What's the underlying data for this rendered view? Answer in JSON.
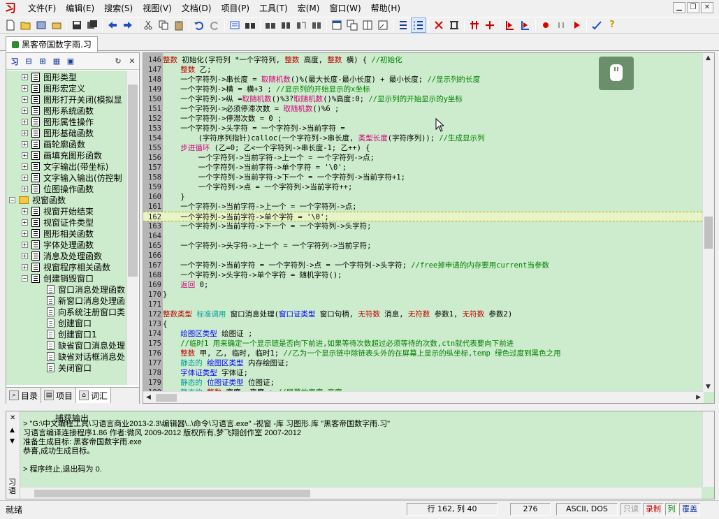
{
  "app": {
    "logo": "习"
  },
  "menu": [
    "文件(F)",
    "编辑(E)",
    "搜索(S)",
    "视图(V)",
    "文档(D)",
    "项目(P)",
    "工具(T)",
    "宏(M)",
    "窗口(W)",
    "帮助(H)"
  ],
  "doc_tab": "黑客帝国数字雨.习",
  "tree": [
    {
      "label": "图形类型",
      "level": 2,
      "icon": "book"
    },
    {
      "label": "图形宏定义",
      "level": 2,
      "icon": "book"
    },
    {
      "label": "图形打开关闭(模拟显",
      "level": 2,
      "icon": "book"
    },
    {
      "label": "图形系统函数",
      "level": 2,
      "icon": "book"
    },
    {
      "label": "图形属性操作",
      "level": 2,
      "icon": "book"
    },
    {
      "label": "图形基础函数",
      "level": 2,
      "icon": "book"
    },
    {
      "label": "画轮廓函数",
      "level": 2,
      "icon": "book"
    },
    {
      "label": "画填充图形函数",
      "level": 2,
      "icon": "book"
    },
    {
      "label": "文字输出(带坐标)",
      "level": 2,
      "icon": "book"
    },
    {
      "label": "文字输入输出(仿控制",
      "level": 2,
      "icon": "book"
    },
    {
      "label": "位图操作函数",
      "level": 2,
      "icon": "book"
    },
    {
      "label": "视窗函数",
      "level": 1,
      "icon": "folder"
    },
    {
      "label": "视窗开始结束",
      "level": 2,
      "icon": "book"
    },
    {
      "label": "视窗证件类型",
      "level": 2,
      "icon": "book"
    },
    {
      "label": "图形相关函数",
      "level": 2,
      "icon": "book"
    },
    {
      "label": "字体处理函数",
      "level": 2,
      "icon": "book"
    },
    {
      "label": "消息及处理函数",
      "level": 2,
      "icon": "book"
    },
    {
      "label": "视窗程序相关函数",
      "level": 2,
      "icon": "book"
    },
    {
      "label": "创建销毁窗口",
      "level": 2,
      "icon": "book"
    },
    {
      "label": "窗口消息处理函数",
      "level": 3,
      "icon": "page"
    },
    {
      "label": "新窗口消息处理函",
      "level": 3,
      "icon": "page"
    },
    {
      "label": "向系统注册窗口类",
      "level": 3,
      "icon": "page"
    },
    {
      "label": "创建窗口",
      "level": 3,
      "icon": "page"
    },
    {
      "label": "创建窗口1",
      "level": 3,
      "icon": "page"
    },
    {
      "label": "缺省窗口消息处理",
      "level": 3,
      "icon": "page"
    },
    {
      "label": "缺省对话框消息处",
      "level": 3,
      "icon": "page"
    },
    {
      "label": "关闭窗口",
      "level": 3,
      "icon": "page"
    }
  ],
  "left_tabs": [
    "目录",
    "项目",
    "词汇"
  ],
  "code_lines": [
    {
      "n": "146",
      "h": "<span class=\"k\">整数</span> 初始化(字符列 *一个字符列, <span class=\"k\">整数</span> 高度, <span class=\"k\">整数</span> 横) { <span class=\"c\">//初始化</span>"
    },
    {
      "n": "147",
      "h": "    <span class=\"k\">整数</span> 乙;"
    },
    {
      "n": "148",
      "h": "    一个字符列->串长度 = <span class=\"f\">取随机数</span>()%(最大长度-最小长度) + 最小长度; <span class=\"c\">//显示列的长度</span>"
    },
    {
      "n": "149",
      "h": "    一个字符列->横 = 横+3 ; <span class=\"c\">//显示列的开始显示的x坐标</span>"
    },
    {
      "n": "150",
      "h": "    一个字符列->纵 =<span class=\"f\">取随机数</span>()%3?<span class=\"f\">取随机数</span>()%高度:0; <span class=\"c\">//显示列的开始显示的y坐标</span>"
    },
    {
      "n": "151",
      "h": "    一个字符列->必须停滞次数 = <span class=\"f\">取随机数</span>()%6 ;"
    },
    {
      "n": "152",
      "h": "    一个字符列->停滞次数 = 0 ;"
    },
    {
      "n": "153",
      "h": "    一个字符列->头字符 = 一个字符列->当前字符 ="
    },
    {
      "n": "154",
      "h": "        (字符序列指针)calloc(一个字符列->串长度, <span class=\"f\">类型长度</span>(字符序列)); <span class=\"c\">//生成显示列</span>"
    },
    {
      "n": "155",
      "h": "    <span class=\"f\">步进循环</span> (乙=0; 乙<一个字符列->串长度-1; 乙++) {"
    },
    {
      "n": "156",
      "h": "        一个字符列->当前字符->上一个 = 一个字符列->点;"
    },
    {
      "n": "157",
      "h": "        一个字符列->当前字符->单个字符 = '\\0';"
    },
    {
      "n": "158",
      "h": "        一个字符列->当前字符->下一个 = 一个字符列->当前字符+1;"
    },
    {
      "n": "159",
      "h": "        一个字符列->点 = 一个字符列->当前字符++;"
    },
    {
      "n": "160",
      "h": "    }"
    },
    {
      "n": "161",
      "h": "    一个字符列->当前字符->上一个 = 一个字符列->点;"
    },
    {
      "n": "162",
      "h": "    一个字符列->当前字符->单个字符 = '\\0';",
      "cur": true
    },
    {
      "n": "163",
      "h": "    一个字符列->当前字符->下一个 = 一个字符列->头字符;"
    },
    {
      "n": "164",
      "h": ""
    },
    {
      "n": "165",
      "h": "    一个字符列->头字符->上一个 = 一个字符列->当前字符;"
    },
    {
      "n": "166",
      "h": ""
    },
    {
      "n": "167",
      "h": "    一个字符列->当前字符 = 一个字符列->点 = 一个字符列->头字符; <span class=\"c\">//free掉申请的内存要用current当参数</span>"
    },
    {
      "n": "168",
      "h": "    一个字符列->头字符->单个字符 = 随机字符();"
    },
    {
      "n": "169",
      "h": "    <span class=\"f\">返回</span> 0;"
    },
    {
      "n": "170",
      "h": "}"
    },
    {
      "n": "171",
      "h": ""
    },
    {
      "n": "172",
      "h": "<span class=\"k\">整数类型</span> <span class=\"t\">标准调用</span> 窗口消息处理(<span class=\"b\">窗口证类型</span> 窗口句柄, <span class=\"k\">无符数</span> 消息, <span class=\"k\">无符数</span> 参数1, <span class=\"k\">无符数</span> 参数2)"
    },
    {
      "n": "173",
      "h": "{"
    },
    {
      "n": "174",
      "h": "    <span class=\"b\">绘图区类型</span> 绘图证 ;"
    },
    {
      "n": "175",
      "h": "    <span class=\"c\">//临时1 用来确定一个显示链是否向下前进,如果等待次数超过必须等待的次数,ctn就代表要向下前进</span>"
    },
    {
      "n": "176",
      "h": "    <span class=\"k\">整数</span> 甲, 乙, 临时, 临时1; <span class=\"c\">//乙为一个显示链中除链表头外的在屏幕上显示的纵坐标,temp 绿色过度到黑色之用</span>"
    },
    {
      "n": "177",
      "h": "    <span class=\"t\">静态的</span> <span class=\"b\">绘图区类型</span> 内存绘图证;"
    },
    {
      "n": "178",
      "h": "    <span class=\"b\">字体证类型</span> 字体证;"
    },
    {
      "n": "179",
      "h": "    <span class=\"t\">静态的</span> <span class=\"b\">位图证类型</span> 位图证;"
    },
    {
      "n": "180",
      "h": "    <span class=\"t\">静态的</span> <span class=\"k\">整数</span> 宽度, 高度 ; <span class=\"c\">//屏幕的宽度 高度</span>"
    }
  ],
  "output": {
    "title": "捕获输出",
    "lines": [
      "> \"G:\\中文编程工具\\习语言商业2013-2.3\\编辑器\\..\\命令\\习语言.exe\" -视窗 -库 习图形.库 \"黑客帝国数字雨.习\"",
      "习语言编译连接程序1.86  作者:微风  2009-2012  版权所有,梦飞翔创作室 2007-2012",
      "准备生成目标: 黑客帝国数字雨.exe",
      "恭喜,成功生成目标。",
      "",
      "> 程序终止,退出码为 0."
    ],
    "side_label": "习语"
  },
  "status": {
    "ready": "就绪",
    "position": "行 162, 列 40",
    "code": "276",
    "encoding": "ASCII, DOS",
    "readonly": "只读",
    "record": "录制",
    "col": "列",
    "overwrite": "覆盖"
  }
}
